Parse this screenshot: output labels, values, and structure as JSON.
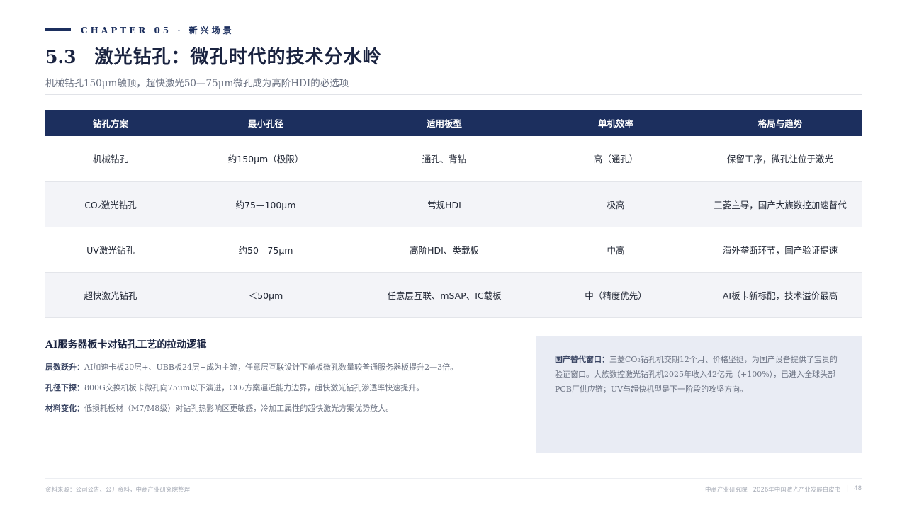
{
  "header": {
    "chapter": "CHAPTER 05 · 新兴场景",
    "number": "5.3",
    "title": "激光钻孔：微孔时代的技术分水岭",
    "subtitle": "机械钻孔150μm触顶，超快激光50—75μm微孔成为高阶HDI的必选项"
  },
  "table": {
    "columns": [
      "钻孔方案",
      "最小孔径",
      "适用板型",
      "单机效率",
      "格局与趋势"
    ],
    "rows": [
      [
        "机械钻孔",
        "约150μm（极限）",
        "通孔、背钻",
        "高（通孔）",
        "保留工序，微孔让位于激光"
      ],
      [
        "CO₂激光钻孔",
        "约75—100μm",
        "常规HDI",
        "极高",
        "三菱主导，国产大族数控加速替代"
      ],
      [
        "UV激光钻孔",
        "约50—75μm",
        "高阶HDI、类载板",
        "中高",
        "海外垄断环节，国产验证提速"
      ],
      [
        "超快激光钻孔",
        "＜50μm",
        "任意层互联、mSAP、IC载板",
        "中（精度优先）",
        "AI板卡新标配，技术溢价最高"
      ]
    ]
  },
  "logic": {
    "title": "AI服务器板卡对钻孔工艺的拉动逻辑",
    "items": [
      {
        "key": "层数跃升：",
        "text": "AI加速卡板20层+、UBB板24层+成为主流，任意层互联设计下单板微孔数量较普通服务器板提升2—3倍。"
      },
      {
        "key": "孔径下探：",
        "text": "800G交换机板卡微孔向75μm以下演进，CO₂方案逼近能力边界，超快激光钻孔渗透率快速提升。"
      },
      {
        "key": "材料变化：",
        "text": "低损耗板材（M7/M8级）对钻孔热影响区更敏感，冷加工属性的超快激光方案优势放大。"
      }
    ]
  },
  "callout": {
    "key": "国产替代窗口：",
    "text": "三菱CO₂钻孔机交期12个月、价格坚挺，为国产设备提供了宝贵的验证窗口。大族数控激光钻孔机2025年收入42亿元（+100%），已进入全球头部PCB厂供应链；UV与超快机型是下一阶段的攻坚方向。"
  },
  "footer": {
    "source": "资料来源：公司公告、公开资料，中商产业研究院整理",
    "publisher": "中商产业研究院 · 2026年中国激光产业发展白皮书",
    "separator": "|",
    "page": "48"
  },
  "colors": {
    "navy": "#1c2f5e",
    "row_alt": "#f3f4f8",
    "callout_bg": "#e9ecf4"
  }
}
